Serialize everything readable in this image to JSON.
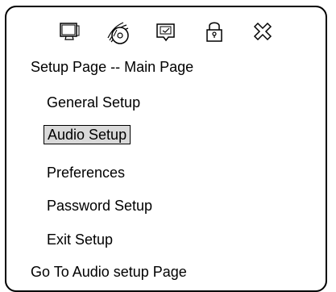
{
  "toolbar": {
    "icons": [
      {
        "name": "monitor-icon",
        "label": "General Setup"
      },
      {
        "name": "audio-cd-icon",
        "label": "Audio Setup"
      },
      {
        "name": "preferences-checkbox-icon",
        "label": "Preferences"
      },
      {
        "name": "lock-icon",
        "label": "Password Setup"
      },
      {
        "name": "exit-x-icon",
        "label": "Exit Setup"
      }
    ]
  },
  "page": {
    "title": "Setup Page -- Main Page"
  },
  "menu": {
    "items": [
      {
        "label": "General Setup",
        "selected": false
      },
      {
        "label": "Audio Setup",
        "selected": true
      },
      {
        "label": "Preferences",
        "selected": false
      },
      {
        "label": "Password Setup",
        "selected": false
      },
      {
        "label": "Exit Setup",
        "selected": false
      }
    ]
  },
  "status": {
    "text": "Go To Audio setup Page"
  },
  "colors": {
    "background": "#ffffff",
    "border": "#000000",
    "selected_background": "#d9d9d9"
  }
}
